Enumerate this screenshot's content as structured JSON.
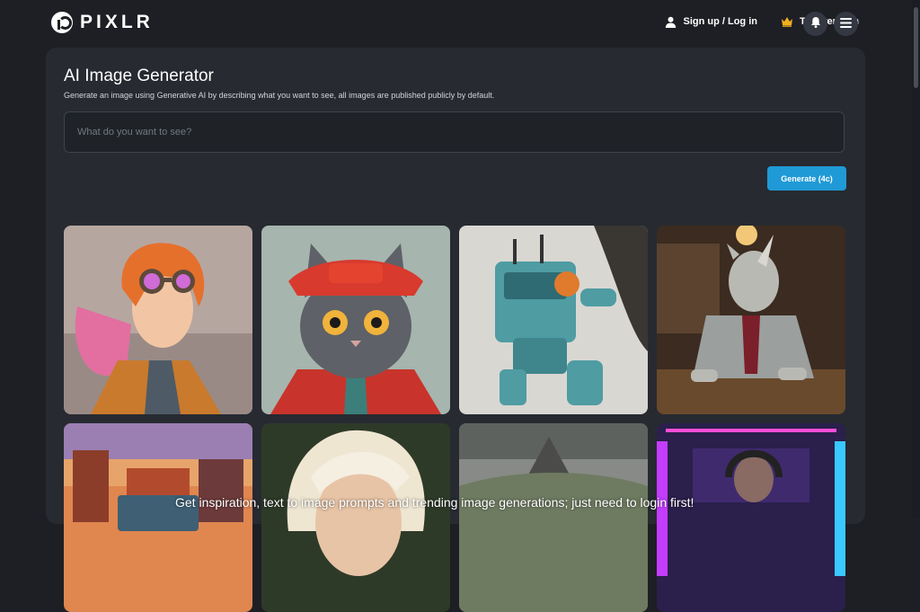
{
  "header": {
    "logo_text": "PIXLR",
    "signup_label": "Sign up / Log in",
    "premium_label": "Try premium",
    "icons": [
      "user-icon",
      "crown-icon",
      "bell-icon",
      "menu-icon"
    ]
  },
  "generator": {
    "title": "AI Image Generator",
    "subtitle": "Generate an image using Generative AI by describing what you want to see, all images are published publicly by default.",
    "prompt_placeholder": "What do you want to see?",
    "prompt_value": "",
    "generate_label": "Generate (4c)"
  },
  "gallery": {
    "items": [
      {
        "subject": "redhead-steampunk-goggles"
      },
      {
        "subject": "gray-cat-red-hat"
      },
      {
        "subject": "teal-robot-mech"
      },
      {
        "subject": "rhino-in-suit-bar"
      },
      {
        "subject": "sunset-city-truck"
      },
      {
        "subject": "blonde-woman"
      },
      {
        "subject": "mountain-landscape"
      },
      {
        "subject": "neon-gamer-headphones"
      }
    ]
  },
  "footer_overlay": {
    "text": "Get inspiration, text to image prompts and trending image generations; just need to login first!"
  },
  "colors": {
    "background": "#1d1f24",
    "panel": "#272a31",
    "accent": "#1f9ad6",
    "crown": "#f2b01e"
  }
}
